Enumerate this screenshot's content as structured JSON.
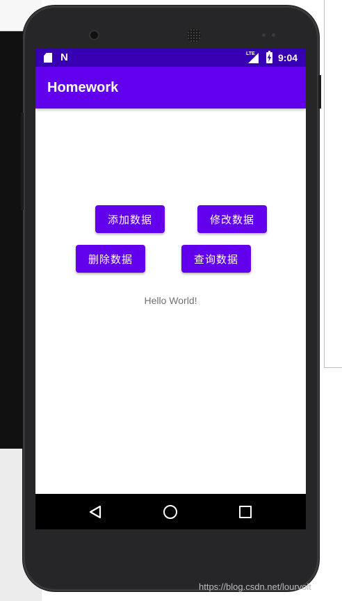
{
  "status_bar": {
    "network_type": "LTE",
    "time": "9:04"
  },
  "app_bar": {
    "title": "Homework"
  },
  "buttons": {
    "add": "添加数据",
    "update": "修改数据",
    "delete": "删除数据",
    "query": "查询数据"
  },
  "content": {
    "hello_text": "Hello World!"
  },
  "watermark": "https://blog.csdn.net/lourvolt",
  "icons": {
    "sd_card": "sd-card-icon",
    "n_notification": "n-notification-icon",
    "signal": "cell-signal-icon",
    "battery": "battery-charging-icon",
    "back": "back-icon",
    "home": "home-icon",
    "recents": "recents-icon"
  },
  "colors": {
    "status_bar": "#3700b3",
    "app_bar": "#6200ee",
    "button": "#6200ee",
    "nav_bar": "#000000"
  }
}
